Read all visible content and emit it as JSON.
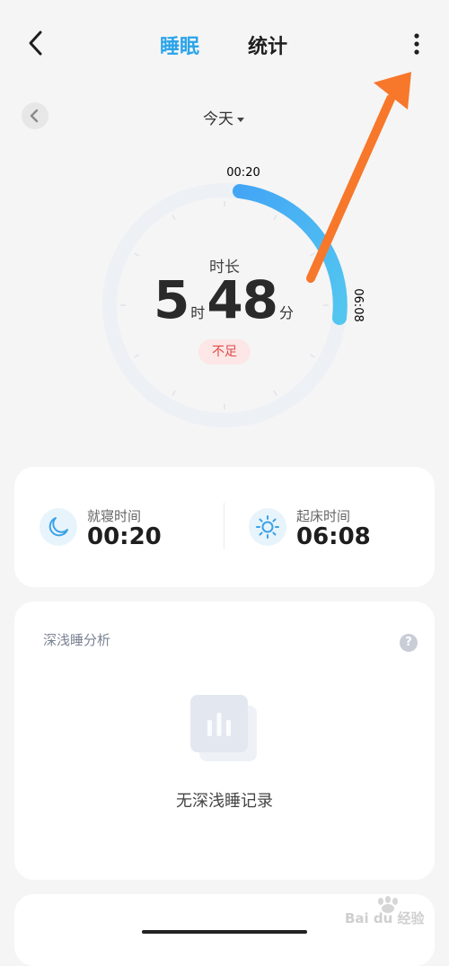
{
  "header": {
    "tabs": [
      {
        "label": "睡眠",
        "active": true
      },
      {
        "label": "统计",
        "active": false
      }
    ]
  },
  "date": {
    "label": "今天"
  },
  "ring": {
    "start_time_label": "00:20",
    "end_time_label": "06:08"
  },
  "summary": {
    "title": "时长",
    "hours": "5",
    "hours_unit": "时",
    "minutes": "48",
    "minutes_unit": "分",
    "status": "不足"
  },
  "times": {
    "bedtime_label": "就寝时间",
    "bedtime_value": "00:20",
    "wake_label": "起床时间",
    "wake_value": "06:08"
  },
  "analysis": {
    "title": "深浅睡分析",
    "help_symbol": "?",
    "empty_text": "无深浅睡记录"
  },
  "watermark": {
    "text": "Bai du 经验"
  },
  "colors": {
    "accent": "#2aa4e9",
    "arc_start": "#43a6f5",
    "arc_end": "#53c6f0",
    "ring_track": "#edf0f5",
    "status_text": "#e04a4a",
    "status_bg": "#fde6e6",
    "annotation_arrow": "#f7772b"
  }
}
